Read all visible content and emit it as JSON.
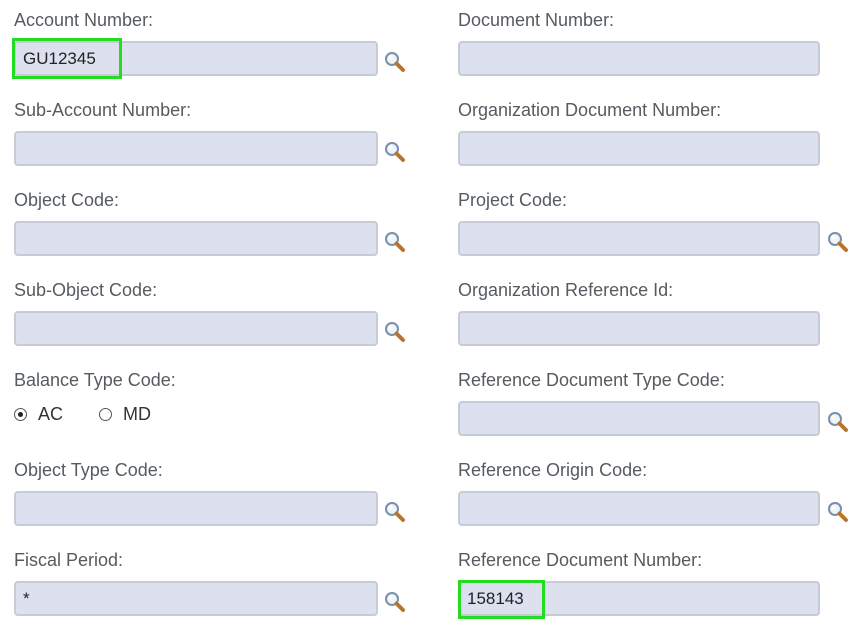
{
  "left": {
    "account_number": {
      "label": "Account Number:",
      "value": "GU12345"
    },
    "sub_account_number": {
      "label": "Sub-Account Number:",
      "value": ""
    },
    "object_code": {
      "label": "Object Code:",
      "value": ""
    },
    "sub_object_code": {
      "label": "Sub-Object Code:",
      "value": ""
    },
    "balance_type_code": {
      "label": "Balance Type Code:",
      "options": [
        "AC",
        "MD"
      ],
      "selected": "AC"
    },
    "object_type_code": {
      "label": "Object Type Code:",
      "value": ""
    },
    "fiscal_period": {
      "label": "Fiscal Period:",
      "value": "*"
    }
  },
  "right": {
    "document_number": {
      "label": "Document Number:",
      "value": ""
    },
    "organization_document_number": {
      "label": "Organization Document Number:",
      "value": ""
    },
    "project_code": {
      "label": "Project Code:",
      "value": ""
    },
    "organization_reference_id": {
      "label": "Organization Reference Id:",
      "value": ""
    },
    "reference_document_type_code": {
      "label": "Reference Document Type Code:",
      "value": ""
    },
    "reference_origin_code": {
      "label": "Reference Origin Code:",
      "value": ""
    },
    "reference_document_number": {
      "label": "Reference Document Number:",
      "value": "158143"
    }
  },
  "icons": {
    "lookup": "magnifier-lookup-icon"
  },
  "colors": {
    "field_bg": "#dce0ef",
    "highlight": "#22dd22",
    "label": "#555b60"
  }
}
